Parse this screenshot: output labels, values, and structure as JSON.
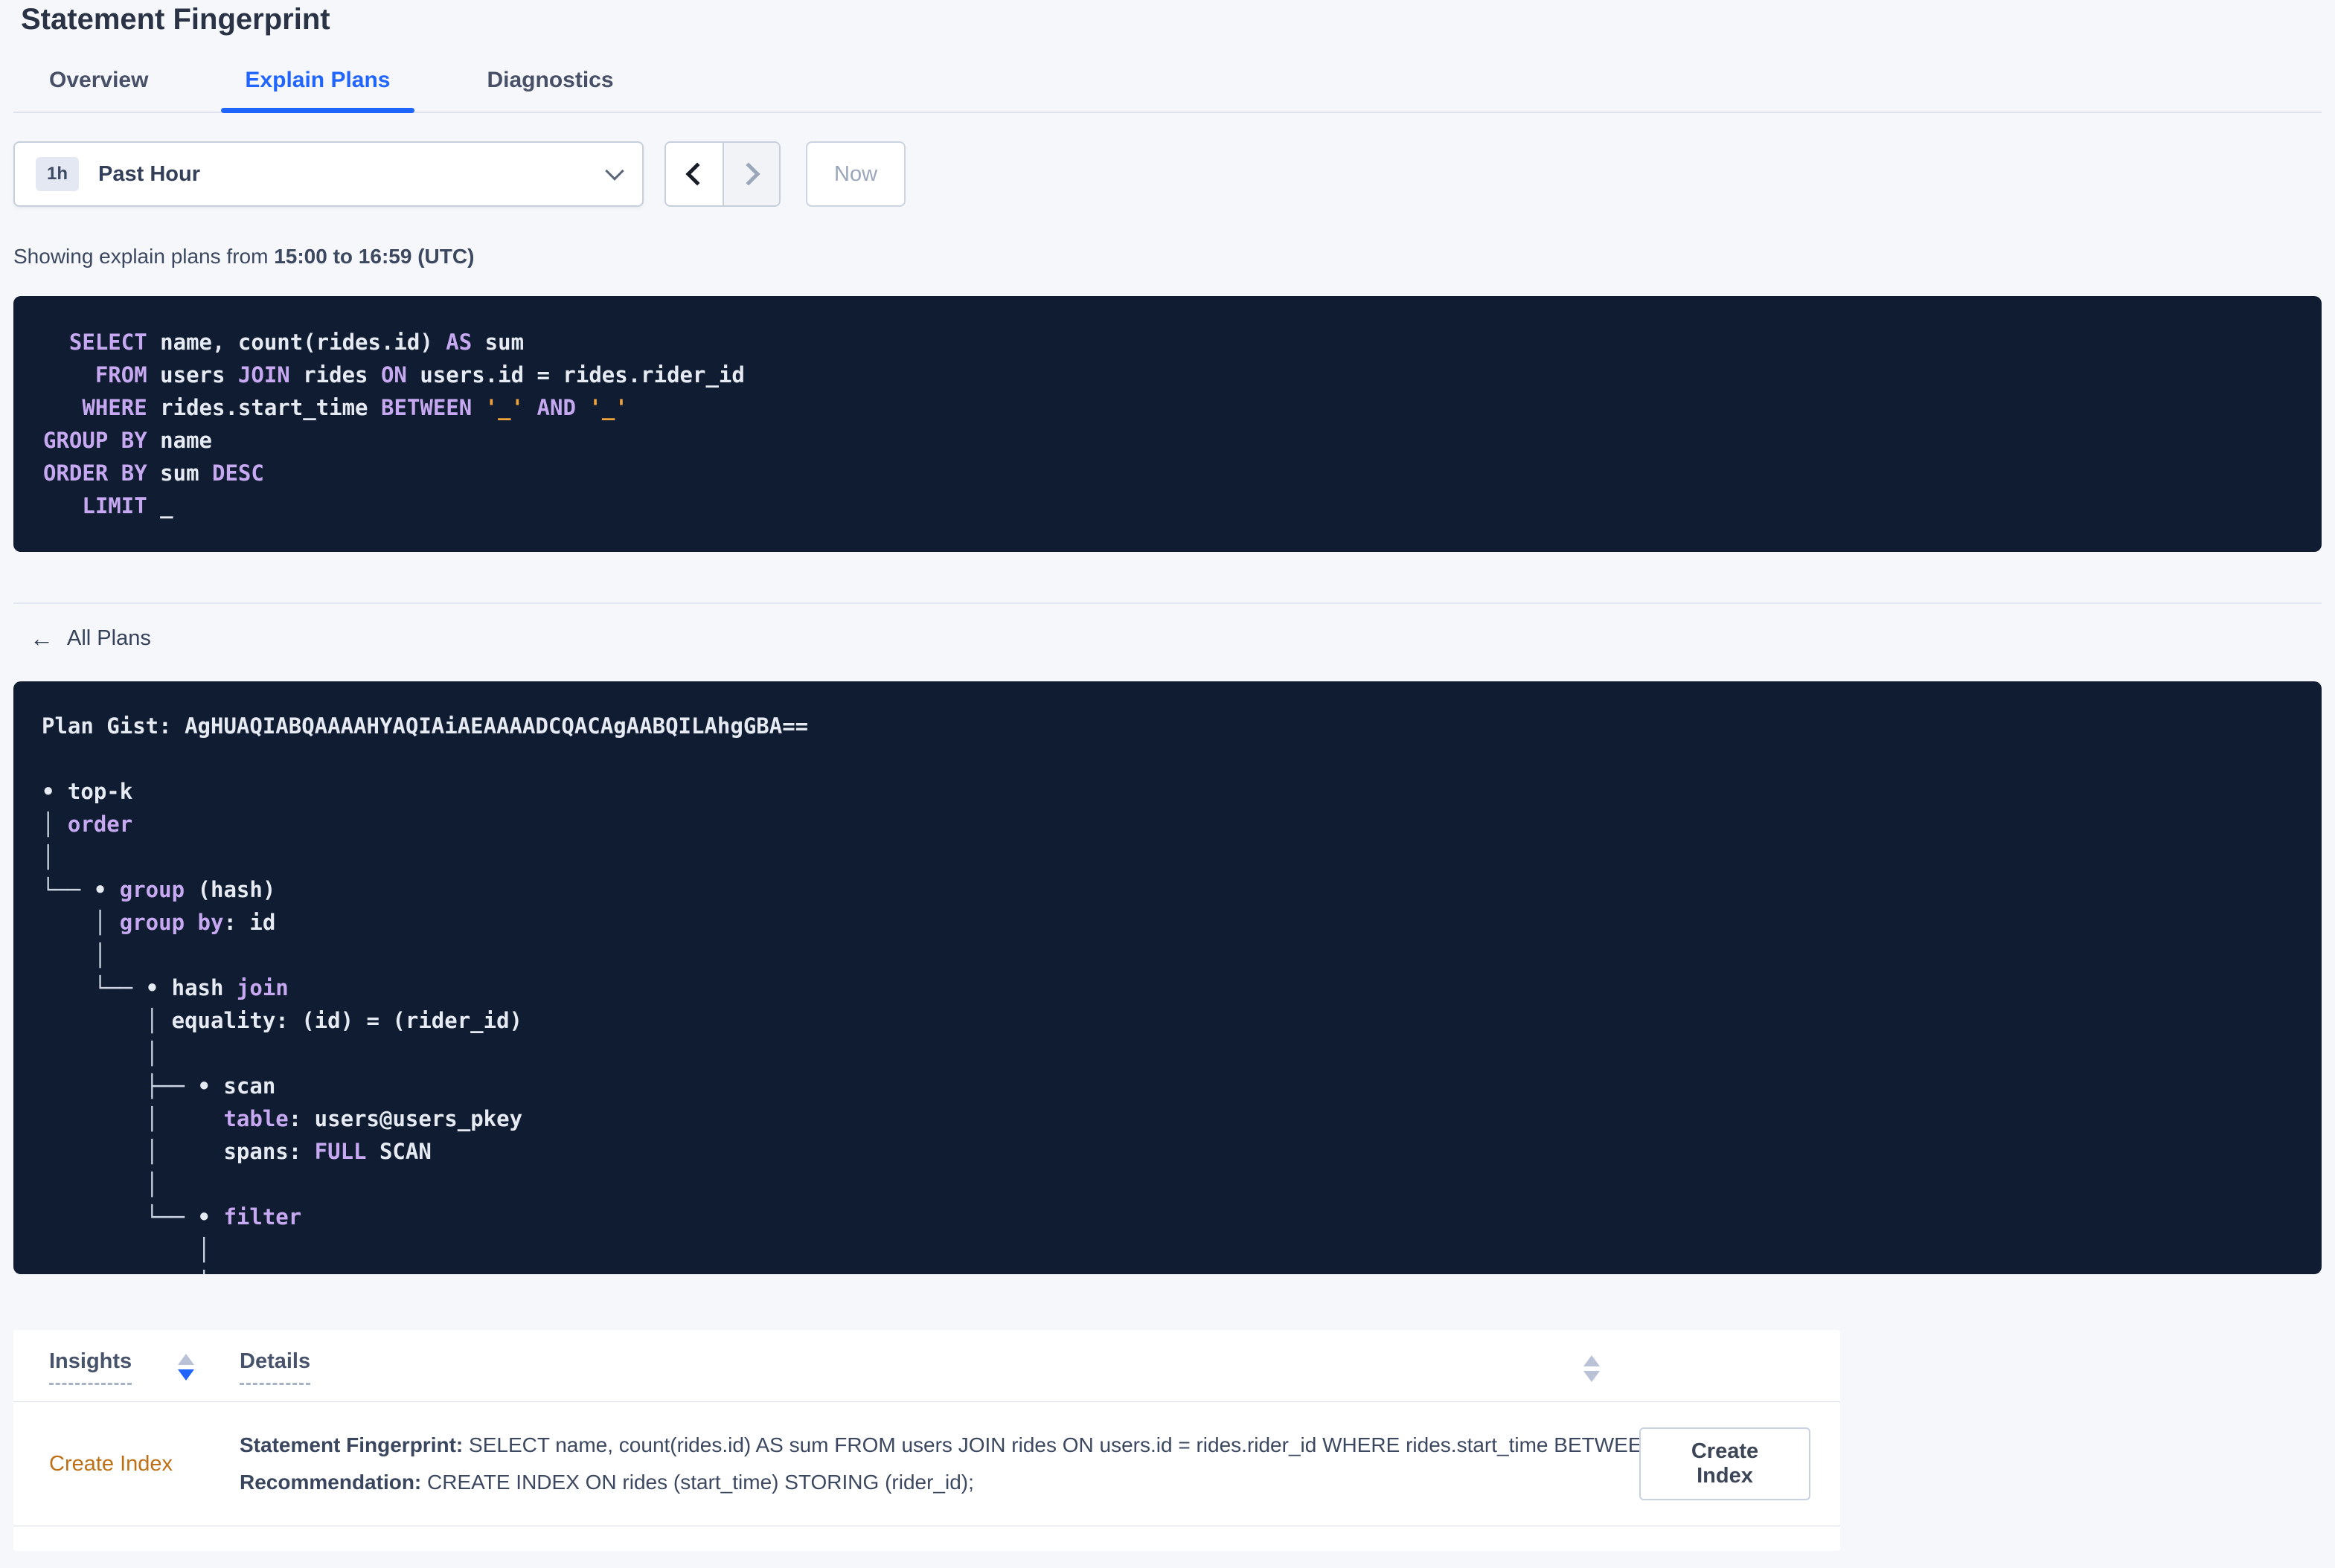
{
  "page": {
    "title": "Statement Fingerprint"
  },
  "tabs": [
    {
      "label": "Overview"
    },
    {
      "label": "Explain Plans"
    },
    {
      "label": "Diagnostics"
    }
  ],
  "time_picker": {
    "badge": "1h",
    "selected": "Past Hour",
    "now_label": "Now"
  },
  "icons": {
    "back_arrow": "←"
  },
  "showing": {
    "prefix": "Showing explain plans from ",
    "range": "15:00 to 16:59 (UTC)"
  },
  "sql": {
    "lines": [
      [
        [
          "t",
          "  "
        ],
        [
          "k",
          "SELECT"
        ],
        [
          "t",
          " name, count(rides.id) "
        ],
        [
          "k",
          "AS"
        ],
        [
          "t",
          " sum"
        ]
      ],
      [
        [
          "t",
          "    "
        ],
        [
          "k",
          "FROM"
        ],
        [
          "t",
          " users "
        ],
        [
          "k",
          "JOIN"
        ],
        [
          "t",
          " rides "
        ],
        [
          "k",
          "ON"
        ],
        [
          "t",
          " users.id = rides.rider_id"
        ]
      ],
      [
        [
          "t",
          "   "
        ],
        [
          "k",
          "WHERE"
        ],
        [
          "t",
          " rides.start_time "
        ],
        [
          "k",
          "BETWEEN"
        ],
        [
          "t",
          " "
        ],
        [
          "s",
          "'_'"
        ],
        [
          "t",
          " "
        ],
        [
          "k",
          "AND"
        ],
        [
          "t",
          " "
        ],
        [
          "s",
          "'_'"
        ]
      ],
      [
        [
          "k",
          "GROUP BY"
        ],
        [
          "t",
          " name"
        ]
      ],
      [
        [
          "k",
          "ORDER BY"
        ],
        [
          "t",
          " sum "
        ],
        [
          "k",
          "DESC"
        ]
      ],
      [
        [
          "t",
          "   "
        ],
        [
          "k",
          "LIMIT"
        ],
        [
          "t",
          " _"
        ]
      ]
    ]
  },
  "all_plans_label": "All Plans",
  "plan": {
    "gist_label": "Plan Gist: ",
    "gist": "AgHUAQIABQAAAAHYAQIAiAEAAAADCQACAgAABQILAhgGBA==",
    "tree": [
      [
        [
          "t",
          "• top-k"
        ]
      ],
      [
        [
          "d",
          "│ "
        ],
        [
          "k",
          "order"
        ]
      ],
      [
        [
          "d",
          "│"
        ]
      ],
      [
        [
          "d",
          "└── "
        ],
        [
          "t",
          "• "
        ],
        [
          "k",
          "group"
        ],
        [
          "t",
          " (hash)"
        ]
      ],
      [
        [
          "d",
          "    │ "
        ],
        [
          "k",
          "group by"
        ],
        [
          "t",
          ": id"
        ]
      ],
      [
        [
          "d",
          "    │"
        ]
      ],
      [
        [
          "d",
          "    └── "
        ],
        [
          "t",
          "• hash "
        ],
        [
          "k",
          "join"
        ]
      ],
      [
        [
          "d",
          "        │ "
        ],
        [
          "t",
          "equality: (id) = (rider_id)"
        ]
      ],
      [
        [
          "d",
          "        │"
        ]
      ],
      [
        [
          "d",
          "        ├── "
        ],
        [
          "t",
          "• scan"
        ]
      ],
      [
        [
          "d",
          "        │"
        ],
        [
          "t",
          "     "
        ],
        [
          "k",
          "table"
        ],
        [
          "t",
          ": users@users_pkey"
        ]
      ],
      [
        [
          "d",
          "        │"
        ],
        [
          "t",
          "     spans: "
        ],
        [
          "k",
          "FULL"
        ],
        [
          "t",
          " SCAN"
        ]
      ],
      [
        [
          "d",
          "        │"
        ],
        [
          "t",
          ""
        ]
      ],
      [
        [
          "d",
          "        └── "
        ],
        [
          "t",
          "• "
        ],
        [
          "k",
          "filter"
        ]
      ],
      [
        [
          "d",
          "            │"
        ]
      ],
      [
        [
          "d",
          "            │"
        ]
      ]
    ]
  },
  "insights_table": {
    "columns": {
      "insights": "Insights",
      "details": "Details"
    },
    "row": {
      "insight": "Create Index",
      "fingerprint_label": "Statement Fingerprint:",
      "fingerprint_text": " SELECT name, count(rides.id) AS sum FROM users JOIN rides ON users.id = rides.rider_id WHERE rides.start_time BETWEEN '_…",
      "recommendation_label": "Recommendation:",
      "recommendation_text": " CREATE INDEX ON rides (start_time) STORING (rider_id);",
      "action_label": "Create Index"
    }
  },
  "colors": {
    "accent_blue": "#2065ff",
    "code_background": "#0f1c31",
    "keyword_purple": "#c7a9f2",
    "code_text": "#e6eaf2",
    "literal_orange": "#f0a23b",
    "insight_orange": "#bf7016",
    "page_background": "#f5f7fa"
  }
}
